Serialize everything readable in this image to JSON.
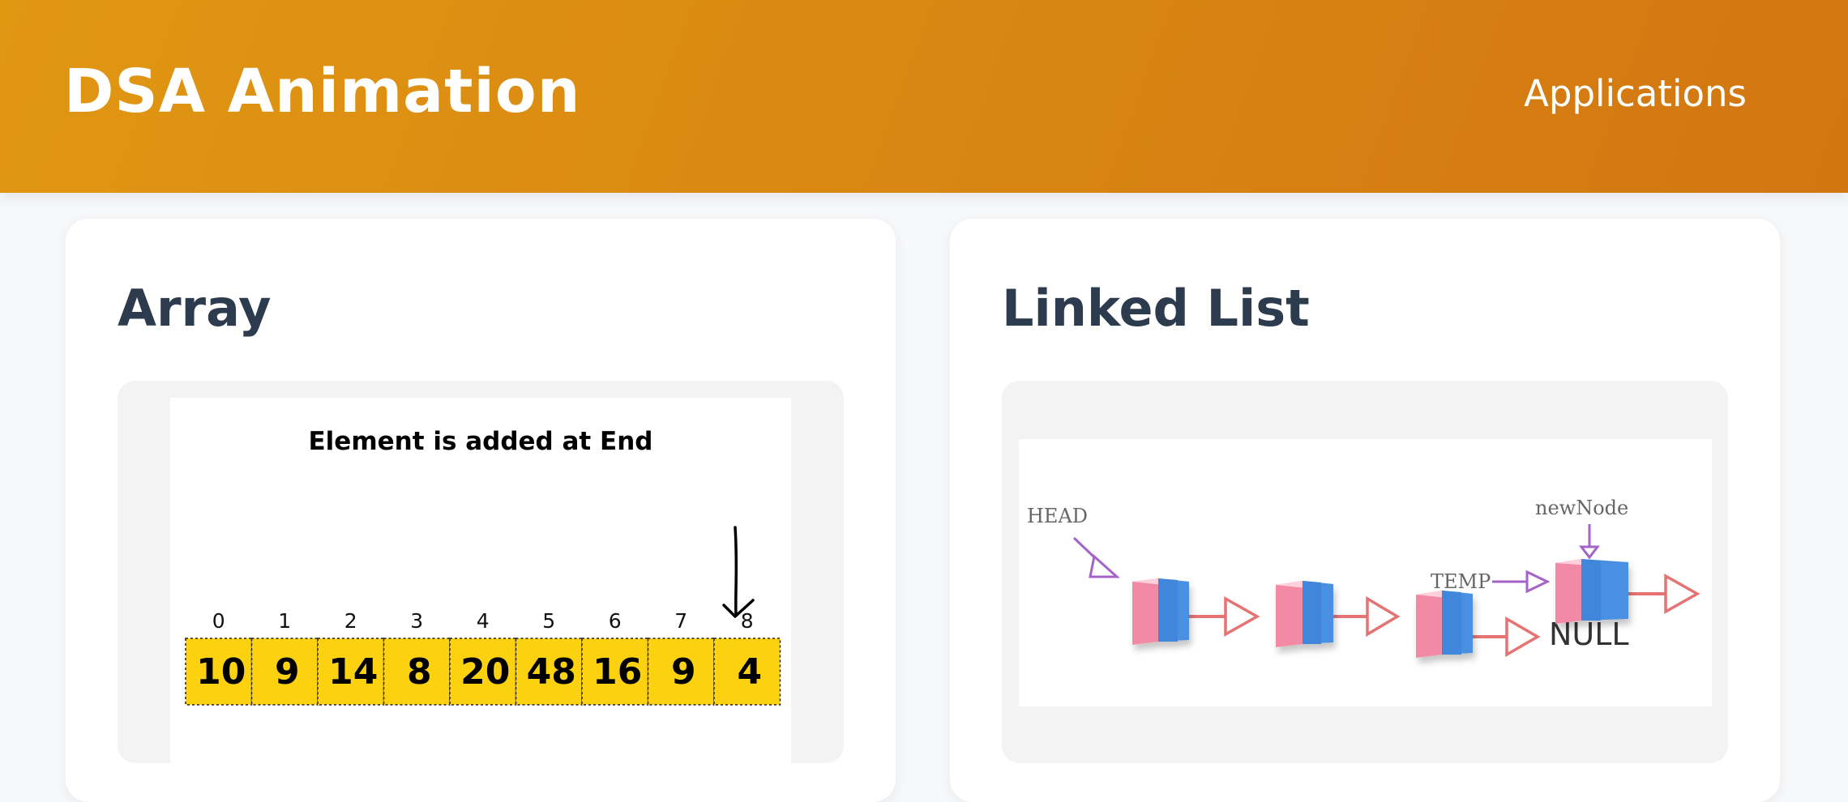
{
  "header": {
    "brand": "DSA Animation",
    "nav_link": "Applications"
  },
  "cards": [
    {
      "title": "Array",
      "illustration": {
        "caption": "Element is added at End",
        "indices": [
          "0",
          "1",
          "2",
          "3",
          "4",
          "5",
          "6",
          "7",
          "8"
        ],
        "values": [
          "10",
          "9",
          "14",
          "8",
          "20",
          "48",
          "16",
          "9",
          "4"
        ]
      }
    },
    {
      "title": "Linked List",
      "illustration": {
        "head_label": "HEAD",
        "temp_label": "TEMP",
        "new_node_label": "newNode",
        "null_label": "NULL"
      }
    }
  ],
  "colors": {
    "header_start": "#e09712",
    "header_end": "#d27612",
    "card_title": "#2d3b4e",
    "array_cell": "#fcd210",
    "node_pink": "#f28aa5",
    "node_blue": "#4a90e2",
    "link_arrow": "#e57373",
    "pointer_arrow": "#a463c9"
  }
}
